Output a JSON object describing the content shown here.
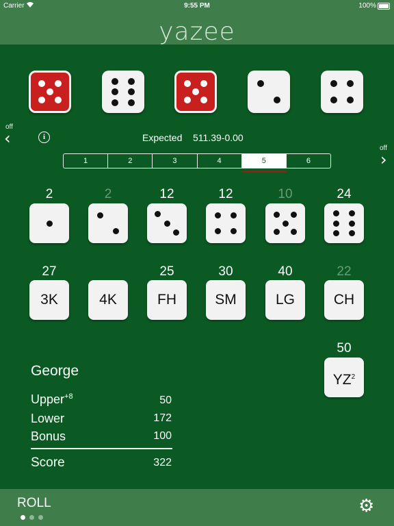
{
  "status_bar": {
    "carrier": "Carrier",
    "time": "9:55 PM",
    "battery": "100%"
  },
  "app": {
    "title": "yazee"
  },
  "dice": [
    {
      "value": 5,
      "held": true
    },
    {
      "value": 6,
      "held": false
    },
    {
      "value": 5,
      "held": true
    },
    {
      "value": 2,
      "held": false
    },
    {
      "value": 4,
      "held": false
    }
  ],
  "nav": {
    "left_label": "off",
    "right_label": "off",
    "left_icon": "chevron-left-icon",
    "right_icon": "chevron-right-icon"
  },
  "expected": {
    "label": "Expected",
    "value": "511.39-0.00"
  },
  "segments": {
    "options": [
      "1",
      "2",
      "3",
      "4",
      "5",
      "6"
    ],
    "selected": "5"
  },
  "upper_scores": [
    {
      "die": 1,
      "score": "2",
      "dim": false
    },
    {
      "die": 2,
      "score": "2",
      "dim": true
    },
    {
      "die": 3,
      "score": "12",
      "dim": false
    },
    {
      "die": 4,
      "score": "12",
      "dim": false
    },
    {
      "die": 5,
      "score": "10",
      "dim": true
    },
    {
      "die": 6,
      "score": "24",
      "dim": false
    }
  ],
  "lower_scores": [
    {
      "label": "3K",
      "score": "27",
      "dim": false
    },
    {
      "label": "4K",
      "score": "",
      "dim": false
    },
    {
      "label": "FH",
      "score": "25",
      "dim": false
    },
    {
      "label": "SM",
      "score": "30",
      "dim": false
    },
    {
      "label": "LG",
      "score": "40",
      "dim": false
    },
    {
      "label": "CH",
      "score": "22",
      "dim": true
    }
  ],
  "yahtzee": {
    "label": "YZ",
    "superscript": "2",
    "score": "50"
  },
  "player": {
    "name": "George",
    "upper_label": "Upper",
    "upper_bonus": "+8",
    "upper_value": "50",
    "lower_label": "Lower",
    "lower_value": "172",
    "bonus_label": "Bonus",
    "bonus_value": "100",
    "score_label": "Score",
    "score_value": "322"
  },
  "toolbar": {
    "roll_label": "ROLL",
    "page_count": 3,
    "active_page": 0,
    "settings_icon": "gear-icon"
  }
}
